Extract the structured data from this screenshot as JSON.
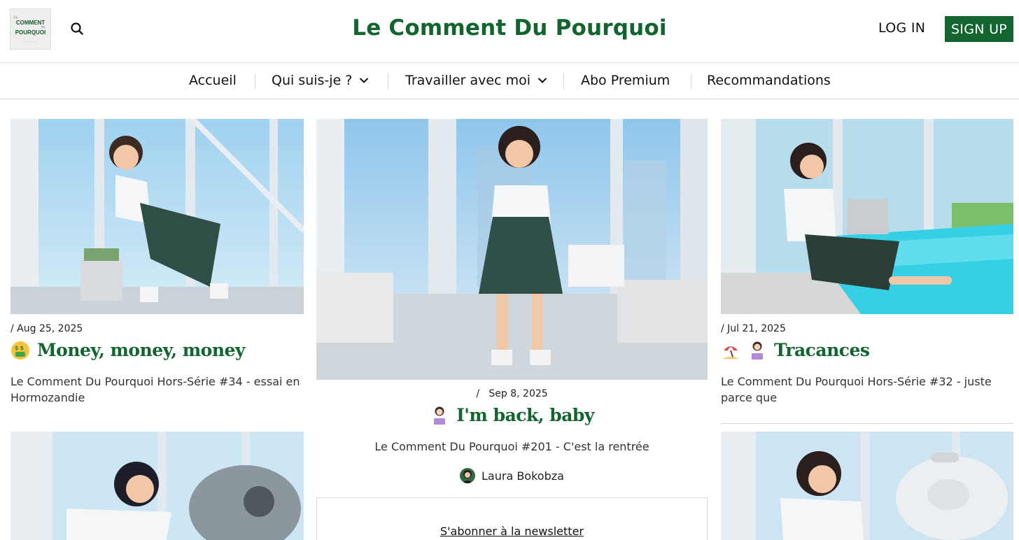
{
  "header": {
    "logo_text": [
      "Le",
      "COMMENT",
      "du",
      "POURQUOI",
      "— ——  ——"
    ],
    "site_title": "Le Comment Du Pourquoi",
    "login_label": "LOG IN",
    "signup_label": "SIGN UP",
    "search_icon": "search-icon"
  },
  "nav": {
    "items": [
      {
        "label": "Accueil",
        "has_dropdown": false
      },
      {
        "label": "Qui suis-je ?",
        "has_dropdown": true
      },
      {
        "label": "Travailler avec moi",
        "has_dropdown": true
      },
      {
        "label": "Abo Premium",
        "has_dropdown": false
      },
      {
        "label": "Recommandations",
        "has_dropdown": false
      }
    ]
  },
  "posts": {
    "left": {
      "date": "/ Aug 25, 2025",
      "emoji": "money-mouth-face-icon",
      "title": "Money, money, money",
      "subtitle": "Le Comment Du Pourquoi Hors-Série #34 - essai en Hormozandie"
    },
    "center": {
      "date": "/   Sep 8, 2025",
      "emoji": "woman-technologist-icon",
      "title": "I'm back, baby",
      "subtitle": "Le Comment Du Pourquoi #201 - C'est la rentrée",
      "author": "Laura Bokobza"
    },
    "right": {
      "date": "/ Jul 21, 2025",
      "emoji": [
        "beach-umbrella-icon",
        "woman-technologist-icon"
      ],
      "title": "Tracances",
      "subtitle": "Le Comment Du Pourquoi Hors-Série #32 - juste parce que"
    }
  },
  "newsletter": {
    "link_label": "S'abonner à la newsletter"
  },
  "colors": {
    "brand_green": "#12652f",
    "divider": "#d9d9d9"
  }
}
